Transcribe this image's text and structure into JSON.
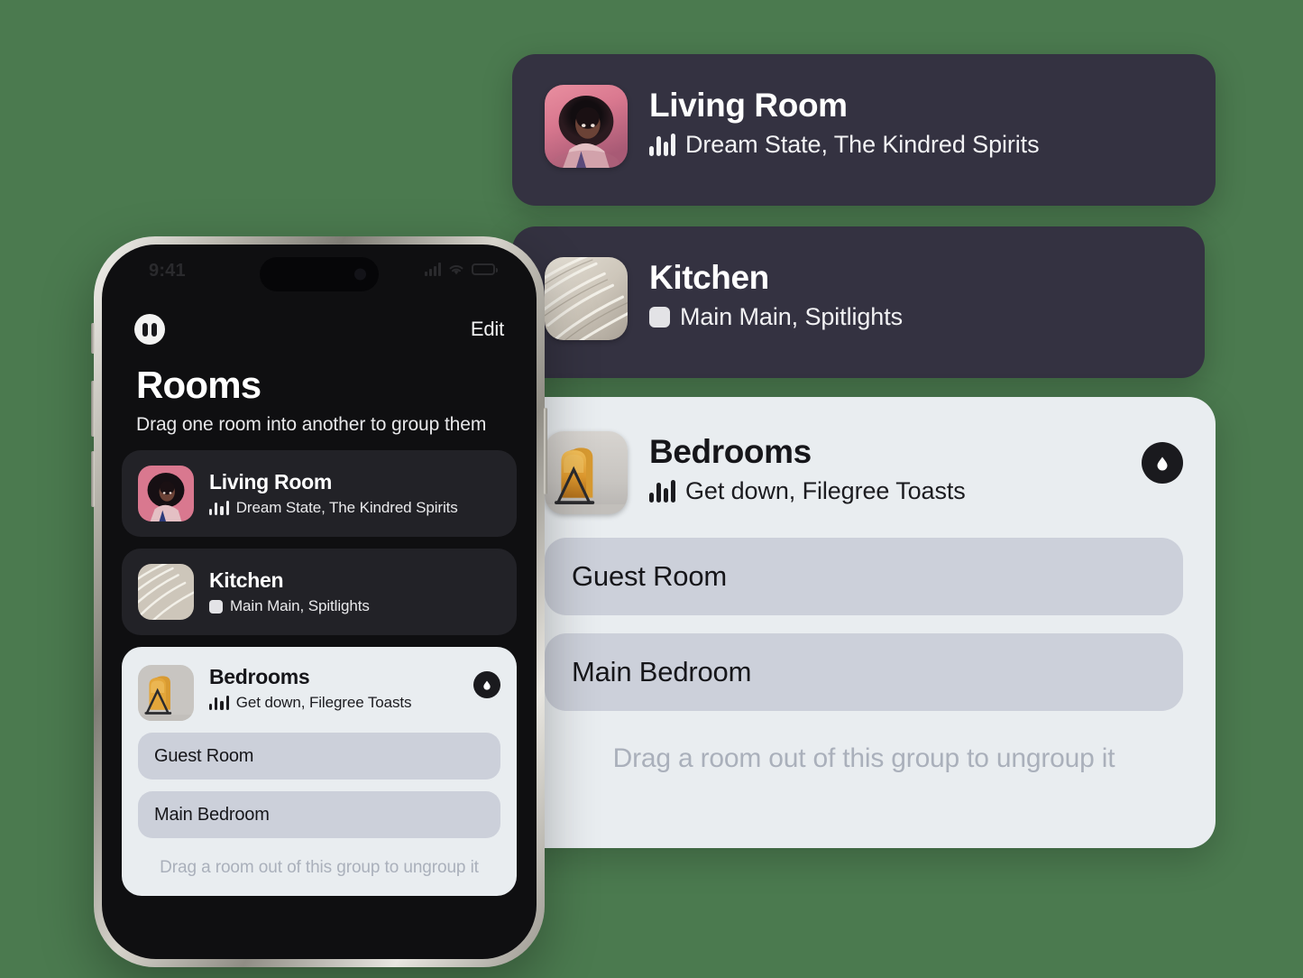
{
  "theme": {
    "background": "#4b7a4f",
    "card_dark": "#343241",
    "card_light": "#e9edf0",
    "pill": "#ccd0da",
    "phone_screen": "#0f0f11",
    "phone_row": "#222227",
    "hint_text": "#aab0bb",
    "badge": "#1a1a1e"
  },
  "cards": {
    "living_room": {
      "title": "Living Room",
      "status": "Dream State, The Kindred Spirits",
      "status_icon": "equalizer-icon",
      "artwork": "portrait-album-art"
    },
    "kitchen": {
      "title": "Kitchen",
      "status": "Main Main, Spitlights",
      "status_icon": "stop-square-icon",
      "artwork": "sand-ripples-album-art"
    },
    "bedrooms": {
      "title": "Bedrooms",
      "status": "Get down, Filegree Toasts",
      "status_icon": "equalizer-icon",
      "artwork": "toast-rack-album-art",
      "badge_icon": "speaker-group-icon",
      "rooms": [
        "Guest Room",
        "Main Bedroom"
      ],
      "hint": "Drag a room out of this group to ungroup it"
    }
  },
  "phone": {
    "status_bar": {
      "time": "9:41",
      "cellular_icon": "signal-bars-icon",
      "wifi_icon": "wifi-icon",
      "battery_icon": "battery-icon"
    },
    "nav": {
      "logo_icon": "app-logo-icon",
      "edit_label": "Edit"
    },
    "page_title": "Rooms",
    "page_subtitle": "Drag one room into another to group them",
    "rooms": [
      {
        "title": "Living Room",
        "status": "Dream State, The Kindred Spirits",
        "status_icon": "equalizer-icon",
        "artwork": "portrait-album-art"
      },
      {
        "title": "Kitchen",
        "status": "Main Main, Spitlights",
        "status_icon": "stop-square-icon",
        "artwork": "sand-ripples-album-art"
      }
    ],
    "group": {
      "title": "Bedrooms",
      "status": "Get down, Filegree Toasts",
      "status_icon": "equalizer-icon",
      "artwork": "toast-rack-album-art",
      "badge_icon": "speaker-group-icon",
      "rooms": [
        "Guest Room",
        "Main Bedroom"
      ],
      "hint": "Drag a room out of this group to ungroup it"
    }
  }
}
